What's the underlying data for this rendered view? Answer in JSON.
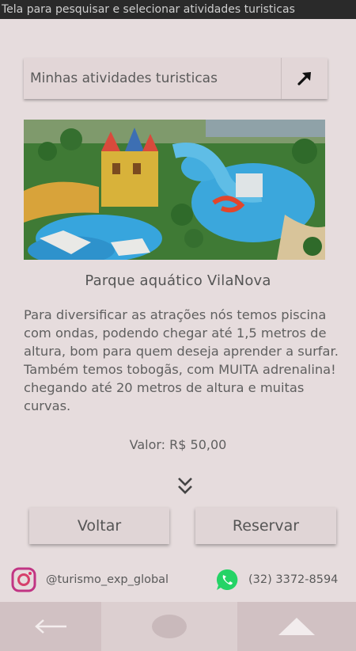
{
  "window": {
    "title": "Tela para pesquisar e selecionar atividades turisticas"
  },
  "search": {
    "label": "Minhas atividades turisticas",
    "icon": "arrow-up-right-icon"
  },
  "attraction": {
    "title": "Parque aquático VilaNova",
    "description": "Para diversificar as atrações nós temos piscina com ondas, podendo chegar até 1,5 metros de altura, bom para quem deseja aprender a surfar.  Também temos tobogãs, com MUITA adrenalina! chegando até 20 metros de altura e muitas curvas.",
    "price": "Valor: R$ 50,00"
  },
  "actions": {
    "back_label": "Voltar",
    "reserve_label": "Reservar"
  },
  "contacts": {
    "instagram": {
      "icon": "instagram-icon",
      "handle": "@turismo_exp_global"
    },
    "whatsapp": {
      "icon": "whatsapp-icon",
      "phone": "(32) 3372-8594"
    }
  },
  "colors": {
    "background": "#e6dcdd",
    "text": "#5f5f5f",
    "title_bar": "#2a2a2a",
    "nav_bar": "#d1c1c3",
    "whatsapp": "#25d366",
    "instagram": "#c13584"
  }
}
